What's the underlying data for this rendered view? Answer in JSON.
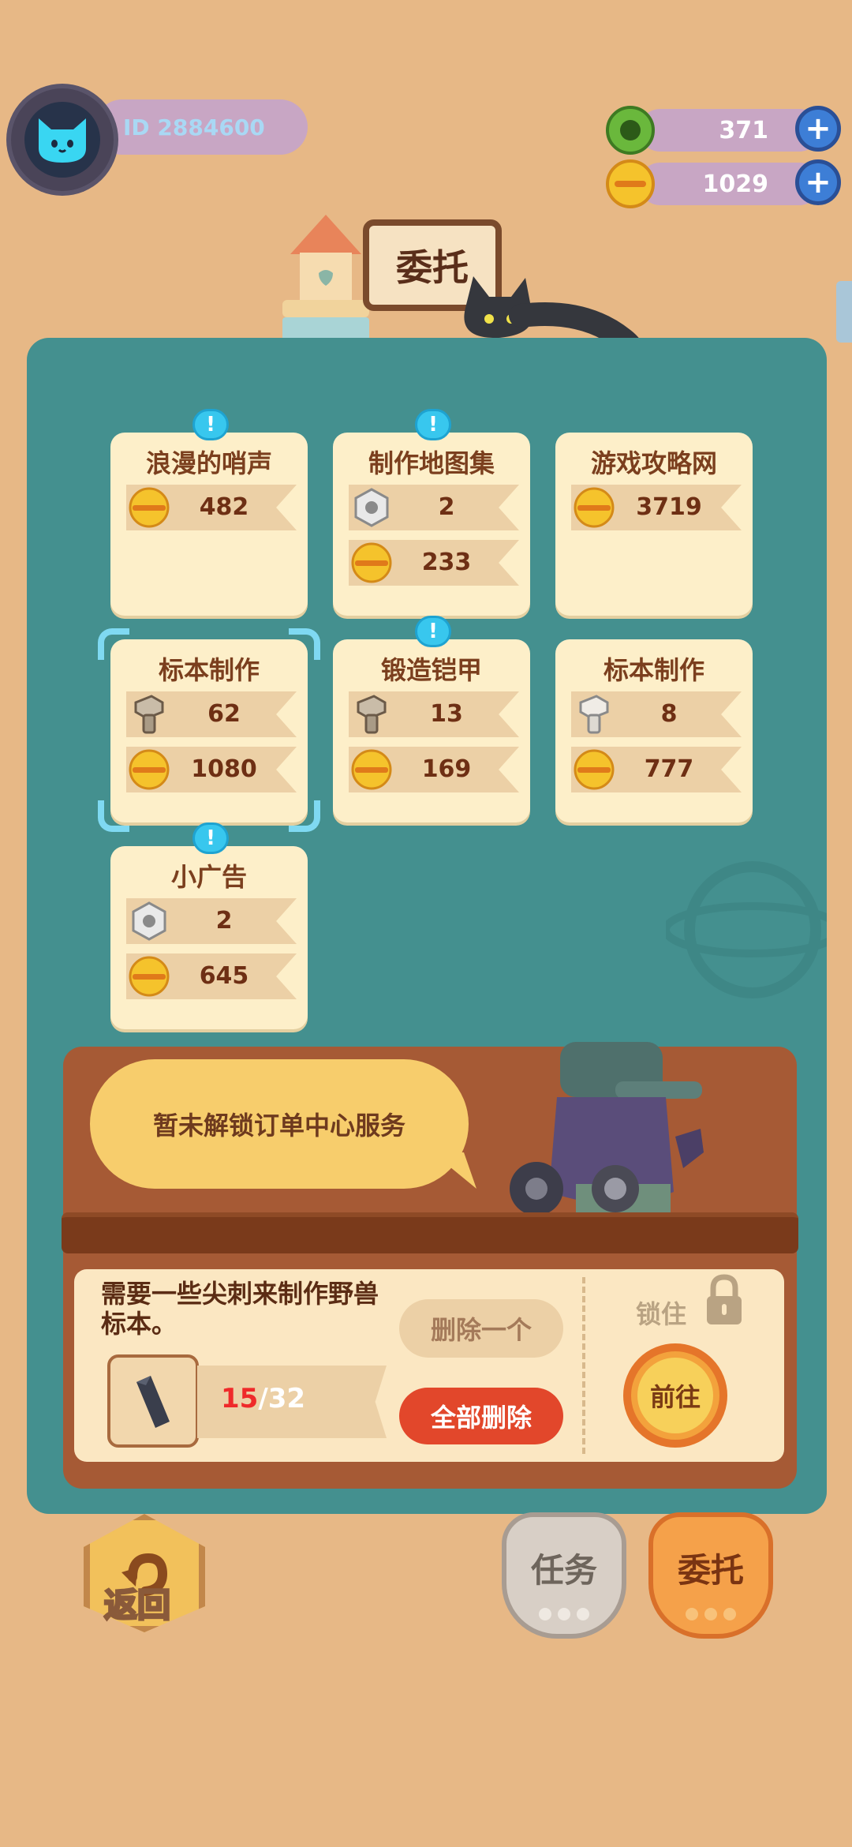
{
  "header": {
    "user_id": "ID 2884600",
    "gems": "371",
    "coins": "1029"
  },
  "title": "委托",
  "cards": [
    {
      "title": "浪漫的哨声",
      "has_alert": true,
      "rewards": [
        {
          "icon": "coin-icon",
          "value": "482"
        }
      ]
    },
    {
      "title": "制作地图集",
      "has_alert": true,
      "rewards": [
        {
          "icon": "nut-icon",
          "value": "2"
        },
        {
          "icon": "coin-icon",
          "value": "233"
        }
      ]
    },
    {
      "title": "游戏攻略网",
      "has_alert": false,
      "rewards": [
        {
          "icon": "coin-icon",
          "value": "3719"
        }
      ]
    },
    {
      "title": "标本制作",
      "has_alert": false,
      "selected": true,
      "rewards": [
        {
          "icon": "bolt-icon",
          "value": "62"
        },
        {
          "icon": "coin-icon",
          "value": "1080"
        }
      ]
    },
    {
      "title": "锻造铠甲",
      "has_alert": true,
      "rewards": [
        {
          "icon": "bolt-icon",
          "value": "13"
        },
        {
          "icon": "coin-icon",
          "value": "169"
        }
      ]
    },
    {
      "title": "标本制作",
      "has_alert": false,
      "rewards": [
        {
          "icon": "bolt-icon",
          "value": "8"
        },
        {
          "icon": "coin-icon",
          "value": "777"
        }
      ]
    },
    {
      "title": "小广告",
      "has_alert": true,
      "rewards": [
        {
          "icon": "nut-icon",
          "value": "2"
        },
        {
          "icon": "coin-icon",
          "value": "645"
        }
      ]
    }
  ],
  "alert_glyph": "!",
  "order": {
    "speech": "暂未解锁订单中心服务",
    "description": "需要一些尖刺来制作野兽标本。",
    "current": "15",
    "separator": "/",
    "total": "32",
    "delete_one": "删除一个",
    "delete_all": "全部删除",
    "lock_label": "锁住",
    "go_label": "前往"
  },
  "bottom": {
    "back_label": "返回",
    "tab_tasks": "任务",
    "tab_commission": "委托"
  },
  "colors": {
    "background": "#e7b886",
    "panel": "#44908f",
    "card": "#fdefc9",
    "accent_red": "#e2472b",
    "alert_blue": "#38c7ee"
  }
}
